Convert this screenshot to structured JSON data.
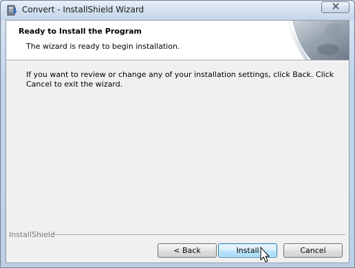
{
  "window": {
    "title": "Convert - InstallShield Wizard"
  },
  "banner": {
    "heading": "Ready to Install the Program",
    "subheading": "The wizard is ready to begin installation."
  },
  "main": {
    "instructions": "If you want to review or change any of your installation settings, click Back. Click Cancel to exit the wizard."
  },
  "footer": {
    "brand": "InstallShield"
  },
  "buttons": {
    "back_label": "< Back",
    "install_label": "Install",
    "cancel_label": "Cancel"
  },
  "icons": {
    "app": "installer-icon",
    "close": "close-icon",
    "cursor": "mouse-pointer-icon"
  }
}
